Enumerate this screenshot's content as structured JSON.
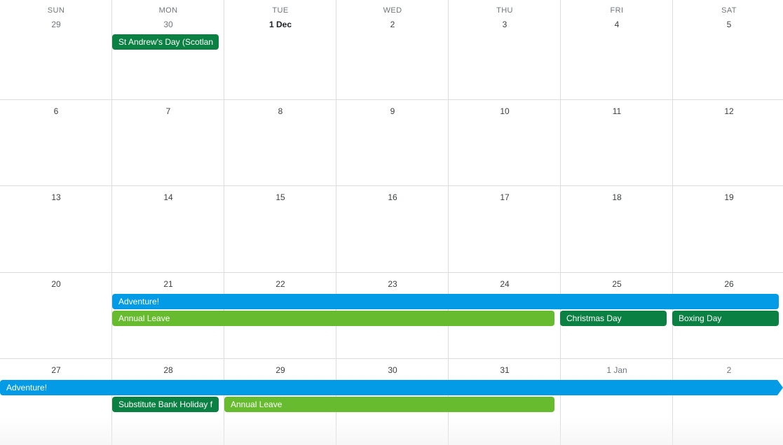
{
  "colors": {
    "holiday_green": "#0b8043",
    "adventure_blue": "#039be5",
    "leave_lime": "#67bb2e",
    "grid_line": "#dadce0"
  },
  "weekdays": [
    "SUN",
    "MON",
    "TUE",
    "WED",
    "THU",
    "FRI",
    "SAT"
  ],
  "weeks": [
    {
      "days": [
        "29",
        "30",
        "1 Dec",
        "2",
        "3",
        "4",
        "5"
      ]
    },
    {
      "days": [
        "6",
        "7",
        "8",
        "9",
        "10",
        "11",
        "12"
      ]
    },
    {
      "days": [
        "13",
        "14",
        "15",
        "16",
        "17",
        "18",
        "19"
      ]
    },
    {
      "days": [
        "20",
        "21",
        "22",
        "23",
        "24",
        "25",
        "26"
      ]
    },
    {
      "days": [
        "27",
        "28",
        "29",
        "30",
        "31",
        "1 Jan",
        "2"
      ]
    }
  ],
  "events": {
    "st_andrews": "St Andrew's Day (Scotlan",
    "adventure_w4": "Adventure!",
    "annual_leave_w4": "Annual Leave",
    "christmas": "Christmas Day",
    "boxing": "Boxing Day",
    "adventure_w5": "Adventure!",
    "substitute_bank": "Substitute Bank Holiday f",
    "annual_leave_w5": "Annual Leave"
  }
}
